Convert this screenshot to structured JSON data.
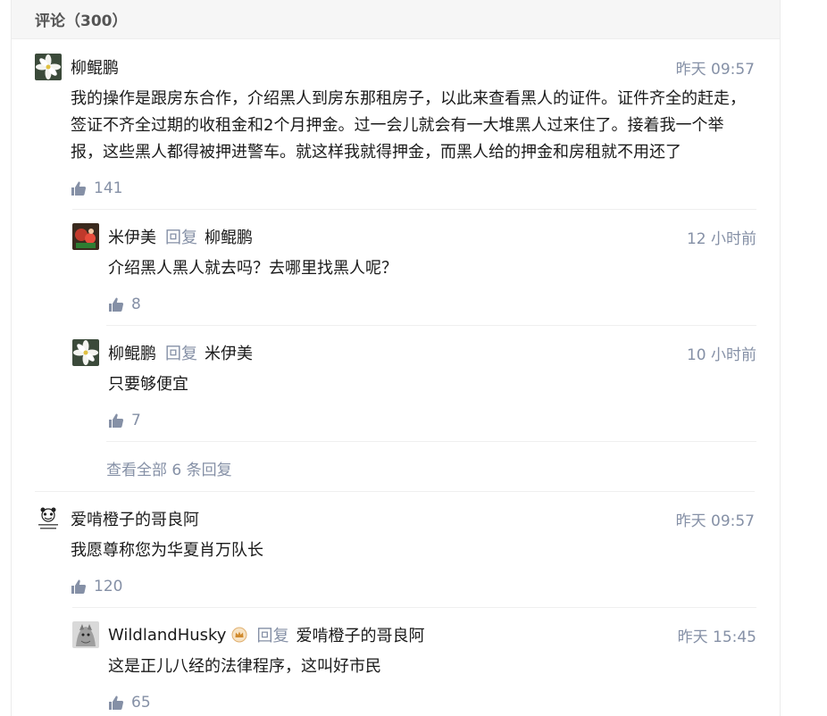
{
  "header": {
    "title": "评论（300）"
  },
  "reply_word": "回复",
  "view_all": "查看全部 6 条回复",
  "comments": [
    {
      "author": "柳鲲鹏",
      "time": "昨天 09:57",
      "text": "我的操作是跟房东合作，介绍黑人到房东那租房子，以此来查看黑人的证件。证件齐全的赶走，签证不齐全过期的收租金和2个月押金。过一会儿就会有一大堆黑人过来住了。接着我一个举报，这些黑人都得被押进警车。就这样我就得押金，而黑人给的押金和房租就不用还了",
      "likes": "141",
      "replies": [
        {
          "author": "米伊美",
          "target": "柳鲲鹏",
          "time": "12 小时前",
          "text": "介绍黑人黑人就去吗？去哪里找黑人呢？",
          "likes": "8"
        },
        {
          "author": "柳鲲鹏",
          "target": "米伊美",
          "time": "10 小时前",
          "text": "只要够便宜",
          "likes": "7"
        }
      ]
    },
    {
      "author": "爱啃橙子的哥良阿",
      "time": "昨天 09:57",
      "text": "我愿尊称您为华夏肖万队长",
      "likes": "120",
      "replies": [
        {
          "author": "WildlandHusky",
          "target": "爱啃橙子的哥良阿",
          "time": "昨天 15:45",
          "text": "这是正儿八经的法律程序，这叫好市民",
          "likes": "65"
        }
      ]
    }
  ]
}
